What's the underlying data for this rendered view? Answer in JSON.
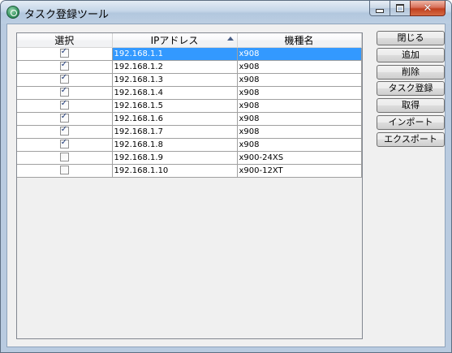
{
  "window": {
    "title": "タスク登録ツール"
  },
  "grid": {
    "columns": [
      "選択",
      "IPアドレス",
      "機種名"
    ],
    "rows": [
      {
        "checked": true,
        "ip": "192.168.1.1",
        "model": "x908",
        "selected": true
      },
      {
        "checked": true,
        "ip": "192.168.1.2",
        "model": "x908",
        "selected": false
      },
      {
        "checked": true,
        "ip": "192.168.1.3",
        "model": "x908",
        "selected": false
      },
      {
        "checked": true,
        "ip": "192.168.1.4",
        "model": "x908",
        "selected": false
      },
      {
        "checked": true,
        "ip": "192.168.1.5",
        "model": "x908",
        "selected": false
      },
      {
        "checked": true,
        "ip": "192.168.1.6",
        "model": "x908",
        "selected": false
      },
      {
        "checked": true,
        "ip": "192.168.1.7",
        "model": "x908",
        "selected": false
      },
      {
        "checked": true,
        "ip": "192.168.1.8",
        "model": "x908",
        "selected": false
      },
      {
        "checked": false,
        "ip": "192.168.1.9",
        "model": "x900-24XS",
        "selected": false
      },
      {
        "checked": false,
        "ip": "192.168.1.10",
        "model": "x900-12XT",
        "selected": false
      }
    ],
    "sort_column": "IPアドレス",
    "sort_direction": "ascending"
  },
  "buttons": {
    "close": "閉じる",
    "add": "追加",
    "delete": "削除",
    "register_task": "タスク登録",
    "fetch": "取得",
    "import": "インポート",
    "export": "エクスポート"
  },
  "colors": {
    "selection": "#3399ff",
    "window_frame": "#b9cbe0",
    "close_button": "#c1401f"
  }
}
